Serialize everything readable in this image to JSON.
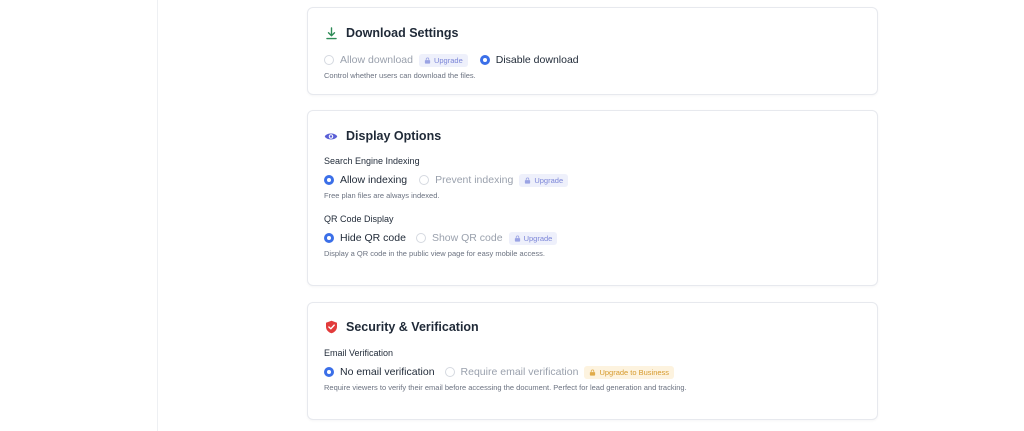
{
  "download": {
    "title": "Download Settings",
    "options": [
      {
        "label": "Allow download",
        "selected": false,
        "badge": "Upgrade"
      },
      {
        "label": "Disable download",
        "selected": true
      }
    ],
    "help": "Control whether users can download the files."
  },
  "display": {
    "title": "Display Options",
    "indexing": {
      "label": "Search Engine Indexing",
      "options": [
        {
          "label": "Allow indexing",
          "selected": true
        },
        {
          "label": "Prevent indexing",
          "selected": false,
          "badge": "Upgrade"
        }
      ],
      "help": "Free plan files are always indexed."
    },
    "qr": {
      "label": "QR Code Display",
      "options": [
        {
          "label": "Hide QR code",
          "selected": true
        },
        {
          "label": "Show QR code",
          "selected": false,
          "badge": "Upgrade"
        }
      ],
      "help": "Display a QR code in the public view page for easy mobile access."
    }
  },
  "security": {
    "title": "Security & Verification",
    "email": {
      "label": "Email Verification",
      "options": [
        {
          "label": "No email verification",
          "selected": true
        },
        {
          "label": "Require email verification",
          "selected": false,
          "badge": "Upgrade to Business"
        }
      ],
      "help": "Require viewers to verify their email before accessing the document. Perfect for lead generation and tracking."
    }
  },
  "colors": {
    "accent": "#3b6fe8",
    "download_icon": "#2e8b57",
    "eye_icon": "#5a5fd6",
    "shield_icon": "#e23b3b",
    "upgrade_badge": "#7c86d8",
    "business_badge": "#d69a2d"
  }
}
